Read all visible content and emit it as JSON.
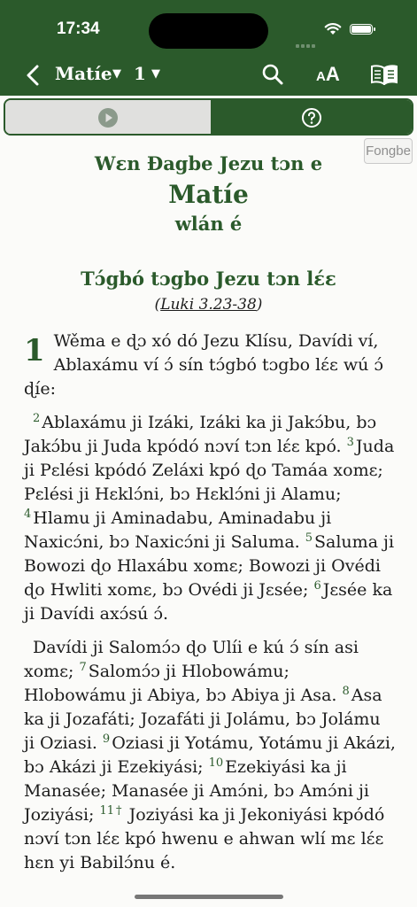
{
  "status": {
    "time": "17:34"
  },
  "nav": {
    "book": "Matíe",
    "chapter": "1",
    "caret": "▼"
  },
  "language_button": "Fongbe",
  "heading": {
    "top": "Wɛn Ɖagbe Jezu tɔn e",
    "main": "Matíe",
    "bottom": "wlán é"
  },
  "section": {
    "title": "Tɔ́gbó tɔgbo Jezu tɔn lɛ́ɛ",
    "xref_open": "(",
    "xref": "Luki 3.23-38",
    "xref_close": ")"
  },
  "chapter_number": "1",
  "verses": {
    "v1": "Wěma e ɖɔ xó dó Jezu Klísu, Davídi ví, Ablaxámu ví ɔ́ sín tɔ́gbó tɔgbo lɛ́ɛ wú ɔ́ ɖíe:",
    "n2": "2",
    "v2": "Ablaxámu ji Izáki, Izáki ka ji Jakɔ́bu, bɔ Jakɔ́bu ji Juda kpódó nɔví tɔn lɛ́ɛ kpó. ",
    "n3": "3",
    "v3": "Juda ji Pɛlési kpódó Zeláxi kpó ɖo Tamáa xomɛ; Pɛlési ji Hɛklɔ́ni, bɔ Hɛklɔ́ni ji Alamu; ",
    "n4": "4",
    "v4": "Hlamu ji Aminadabu, Aminadabu ji Naxicɔ́ni, bɔ Naxicɔ́ni ji Saluma. ",
    "n5": "5",
    "v5": "Saluma ji Bowozi ɖo Hlaxábu xomɛ; Bowozi ji Ovédi ɖo Hwliti xomɛ, bɔ Ovédi ji Jɛsée; ",
    "n6": "6",
    "v6": "Jɛsée ka ji Davídi axɔ́sú ɔ́.",
    "v6b": "Davídi ji Salomɔ́ɔ ɖo Ulíi e kú ɔ́ sín asi xomɛ; ",
    "n7": "7",
    "v7": "Salomɔ́ɔ ji Hlobowámu; Hlobowámu ji Abiya, bɔ Abiya ji Asa. ",
    "n8": "8",
    "v8": "Asa ka ji Jozafáti; Jozafáti ji Jolámu, bɔ Jolámu ji Oziasi. ",
    "n9": "9",
    "v9": "Oziasi ji Yotámu, Yotámu ji Akázi, bɔ Akázi ji Ezekiyási; ",
    "n10": "10",
    "v10": "Ezekiyási ka ji Manasée; Manasée ji Amɔ́ni, bɔ Amɔ́ni ji Joziyási; ",
    "n11": "11",
    "n11mark": "†",
    "v11": " Joziyási ka ji Jekoniyási kpódó nɔví tɔn lɛ́ɛ kpó hwenu e ahwan wlí mɛ lɛ́ɛ hɛn yi Babilɔ́nu é."
  },
  "icons": {
    "back": "chevron-left-icon",
    "search": "search-icon",
    "text_size": "text-size-icon",
    "book": "book-icon",
    "play": "play-icon",
    "help": "help-icon",
    "wifi": "wifi-icon",
    "battery": "battery-icon",
    "signal": "signal-icon"
  },
  "text_size_label": {
    "small": "A",
    "big": "A"
  },
  "colors": {
    "theme_green": "#2b5a2b",
    "background": "#fbfbf9",
    "audio_bar_gray": "#e0e0de"
  }
}
